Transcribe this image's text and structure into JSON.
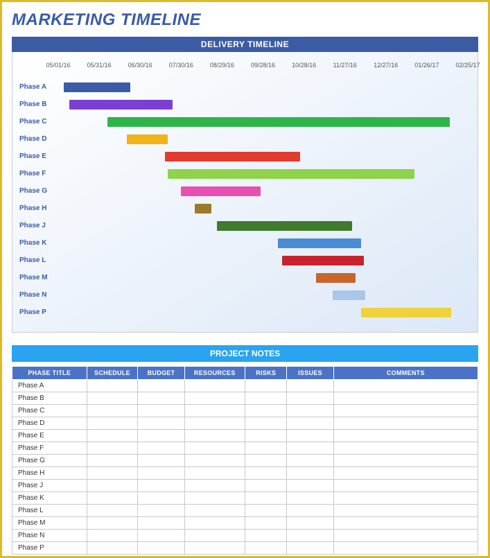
{
  "title": "MARKETING TIMELINE",
  "sections": {
    "timeline_header": "DELIVERY TIMELINE",
    "notes_header": "PROJECT NOTES"
  },
  "chart_data": {
    "type": "bar",
    "orientation": "horizontal-gantt",
    "title": "DELIVERY TIMELINE",
    "xlabel": "",
    "ylabel": "",
    "x_ticks": [
      "05/01/16",
      "05/31/16",
      "06/30/16",
      "07/30/16",
      "08/29/16",
      "09/28/16",
      "10/28/16",
      "11/27/16",
      "12/27/16",
      "01/26/17",
      "02/25/17"
    ],
    "x_range_days": [
      0,
      300
    ],
    "categories": [
      "Phase A",
      "Phase B",
      "Phase C",
      "Phase D",
      "Phase E",
      "Phase F",
      "Phase G",
      "Phase H",
      "Phase J",
      "Phase K",
      "Phase L",
      "Phase M",
      "Phase N",
      "Phase P"
    ],
    "series": [
      {
        "name": "Phase A",
        "start_day": 4,
        "end_day": 53,
        "color": "#3b5ba5"
      },
      {
        "name": "Phase B",
        "start_day": 8,
        "end_day": 84,
        "color": "#7c3fd6"
      },
      {
        "name": "Phase C",
        "start_day": 36,
        "end_day": 287,
        "color": "#2fb44a"
      },
      {
        "name": "Phase D",
        "start_day": 50,
        "end_day": 80,
        "color": "#f0b418"
      },
      {
        "name": "Phase E",
        "start_day": 78,
        "end_day": 177,
        "color": "#e33b2f"
      },
      {
        "name": "Phase F",
        "start_day": 80,
        "end_day": 261,
        "color": "#8fd34a"
      },
      {
        "name": "Phase G",
        "start_day": 90,
        "end_day": 148,
        "color": "#e84fb0"
      },
      {
        "name": "Phase H",
        "start_day": 100,
        "end_day": 112,
        "color": "#9a7a2b"
      },
      {
        "name": "Phase J",
        "start_day": 116,
        "end_day": 215,
        "color": "#3f7a2e"
      },
      {
        "name": "Phase K",
        "start_day": 161,
        "end_day": 222,
        "color": "#4a8bd6"
      },
      {
        "name": "Phase L",
        "start_day": 164,
        "end_day": 224,
        "color": "#c8232c"
      },
      {
        "name": "Phase M",
        "start_day": 189,
        "end_day": 218,
        "color": "#c8652a"
      },
      {
        "name": "Phase N",
        "start_day": 201,
        "end_day": 225,
        "color": "#a9c7e6"
      },
      {
        "name": "Phase P",
        "start_day": 222,
        "end_day": 288,
        "color": "#f0d23a"
      }
    ]
  },
  "notes_table": {
    "columns": [
      "PHASE TITLE",
      "SCHEDULE",
      "BUDGET",
      "RESOURCES",
      "RISKS",
      "ISSUES",
      "COMMENTS"
    ],
    "column_widths_pct": [
      16,
      11,
      10,
      13,
      9,
      10,
      31
    ],
    "rows": [
      {
        "phase": "Phase A",
        "schedule": "",
        "budget": "",
        "resources": "",
        "risks": "",
        "issues": "",
        "comments": ""
      },
      {
        "phase": "Phase B",
        "schedule": "",
        "budget": "",
        "resources": "",
        "risks": "",
        "issues": "",
        "comments": ""
      },
      {
        "phase": "Phase C",
        "schedule": "",
        "budget": "",
        "resources": "",
        "risks": "",
        "issues": "",
        "comments": ""
      },
      {
        "phase": "Phase D",
        "schedule": "",
        "budget": "",
        "resources": "",
        "risks": "",
        "issues": "",
        "comments": ""
      },
      {
        "phase": "Phase E",
        "schedule": "",
        "budget": "",
        "resources": "",
        "risks": "",
        "issues": "",
        "comments": ""
      },
      {
        "phase": "Phase F",
        "schedule": "",
        "budget": "",
        "resources": "",
        "risks": "",
        "issues": "",
        "comments": ""
      },
      {
        "phase": "Phase G",
        "schedule": "",
        "budget": "",
        "resources": "",
        "risks": "",
        "issues": "",
        "comments": ""
      },
      {
        "phase": "Phase H",
        "schedule": "",
        "budget": "",
        "resources": "",
        "risks": "",
        "issues": "",
        "comments": ""
      },
      {
        "phase": "Phase J",
        "schedule": "",
        "budget": "",
        "resources": "",
        "risks": "",
        "issues": "",
        "comments": ""
      },
      {
        "phase": "Phase K",
        "schedule": "",
        "budget": "",
        "resources": "",
        "risks": "",
        "issues": "",
        "comments": ""
      },
      {
        "phase": "Phase L",
        "schedule": "",
        "budget": "",
        "resources": "",
        "risks": "",
        "issues": "",
        "comments": ""
      },
      {
        "phase": "Phase M",
        "schedule": "",
        "budget": "",
        "resources": "",
        "risks": "",
        "issues": "",
        "comments": ""
      },
      {
        "phase": "Phase N",
        "schedule": "",
        "budget": "",
        "resources": "",
        "risks": "",
        "issues": "",
        "comments": ""
      },
      {
        "phase": "Phase P",
        "schedule": "",
        "budget": "",
        "resources": "",
        "risks": "",
        "issues": "",
        "comments": ""
      }
    ]
  }
}
